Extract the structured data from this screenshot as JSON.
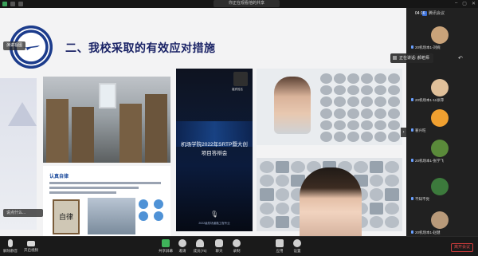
{
  "window": {
    "title_pill": "你正在观看他的共享",
    "clock": "04:16",
    "meeting_label": "腾讯会议"
  },
  "slide": {
    "title": "二、我校采取的有效应对措施",
    "sidebar_tab": "演讲视图",
    "bottom_input": "说点什么...",
    "cover_title": "机场学院2022年SRTP暨大创项目答辩会",
    "cover_footer": "2022级机场道路工程专业",
    "slide2_heading": "认真自律",
    "board_text": "自律",
    "camera_label": "嘉宾姓名"
  },
  "speaker": {
    "note": "正在讲话: 郝老师"
  },
  "participants": [
    {
      "name": "20机场本1-刘婉"
    },
    {
      "name": "20机场本1-11徐萍"
    },
    {
      "name": "翟兴旺"
    },
    {
      "name": "20机场本1-张学飞"
    },
    {
      "name": "不知不觉"
    },
    {
      "name": "20机场本1-赵健"
    }
  ],
  "toolbar": {
    "items": [
      {
        "label": "解除静音",
        "icon": "mic-icon"
      },
      {
        "label": "开启视频",
        "icon": "camera-icon"
      },
      {
        "label": "共享屏幕",
        "icon": "share-screen-icon"
      },
      {
        "label": "邀请",
        "icon": "invite-icon"
      },
      {
        "label": "成员(75)",
        "icon": "members-icon"
      },
      {
        "label": "聊天",
        "icon": "chat-icon"
      },
      {
        "label": "录制",
        "icon": "record-icon"
      },
      {
        "label": "应用",
        "icon": "apps-icon"
      },
      {
        "label": "设置",
        "icon": "settings-icon"
      }
    ],
    "leave": "离开会议"
  },
  "colors": {
    "accent_blue": "#3a6fd8",
    "leave_red": "#e24a4a",
    "title_navy": "#1a2366"
  }
}
